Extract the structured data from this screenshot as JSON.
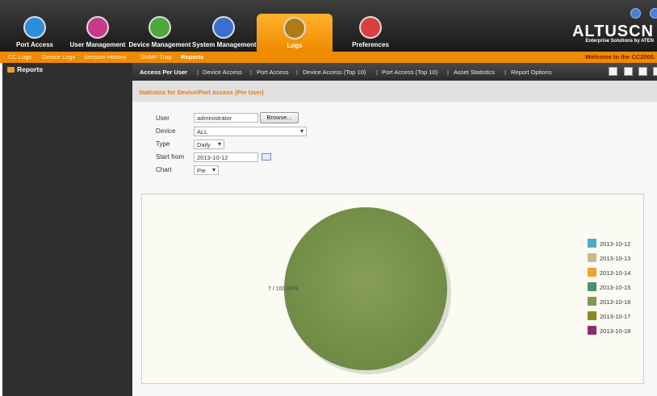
{
  "nav": {
    "items": [
      {
        "label": "Port Access",
        "color": "#2e8ddb"
      },
      {
        "label": "User Management",
        "color": "#c83a8a"
      },
      {
        "label": "Device Management",
        "color": "#4ea83a"
      },
      {
        "label": "System Management",
        "color": "#3a6fd0"
      },
      {
        "label": "Logs",
        "color": "#d9a030"
      },
      {
        "label": "Preferences",
        "color": "#d84040"
      }
    ],
    "active": "Logs",
    "logo": "ALTUSCN",
    "logo_sub": "Enterprise Solutions by ATEN"
  },
  "subnav": {
    "items": [
      "CC Logs",
      "Device Logs",
      "Session History",
      "SNMP Trap",
      "Reports"
    ],
    "active": "Reports",
    "welcome": "Welcome to the CC2000."
  },
  "sidebar": {
    "root_label": "Reports"
  },
  "tabs": {
    "items": [
      "Access Per User",
      "Device Access",
      "Port Access",
      "Device Access (Top 10)",
      "Port Access (Top 10)",
      "Asset Statistics",
      "Report Options"
    ],
    "active": "Access Per User"
  },
  "page": {
    "section_title": "Statistics for Device/Port Access (Per User)"
  },
  "form": {
    "user_label": "User",
    "user_value": "administrator",
    "browse_label": "Browse...",
    "device_label": "Device",
    "device_value": "ALL",
    "type_label": "Type",
    "type_value": "Daily",
    "start_label": "Start from",
    "start_value": "2013-10-12",
    "chart_label": "Chart",
    "chart_value": "Pie"
  },
  "chart_data": {
    "type": "pie",
    "slices": [
      {
        "label": "2013-10-12",
        "value": 0,
        "color": "#4bacc6"
      },
      {
        "label": "2013-10-13",
        "value": 0,
        "color": "#c9b98f"
      },
      {
        "label": "2013-10-14",
        "value": 0,
        "color": "#f0a030"
      },
      {
        "label": "2013-10-15",
        "value": 0,
        "color": "#4f8f6f"
      },
      {
        "label": "2013-10-16",
        "value": 7,
        "color": "#7f9a50"
      },
      {
        "label": "2013-10-17",
        "value": 0,
        "color": "#8a8a1e"
      },
      {
        "label": "2013-10-18",
        "value": 0,
        "color": "#8e2c6e"
      }
    ],
    "slice_label": "7 / 100.00%",
    "legend_position": "right"
  }
}
